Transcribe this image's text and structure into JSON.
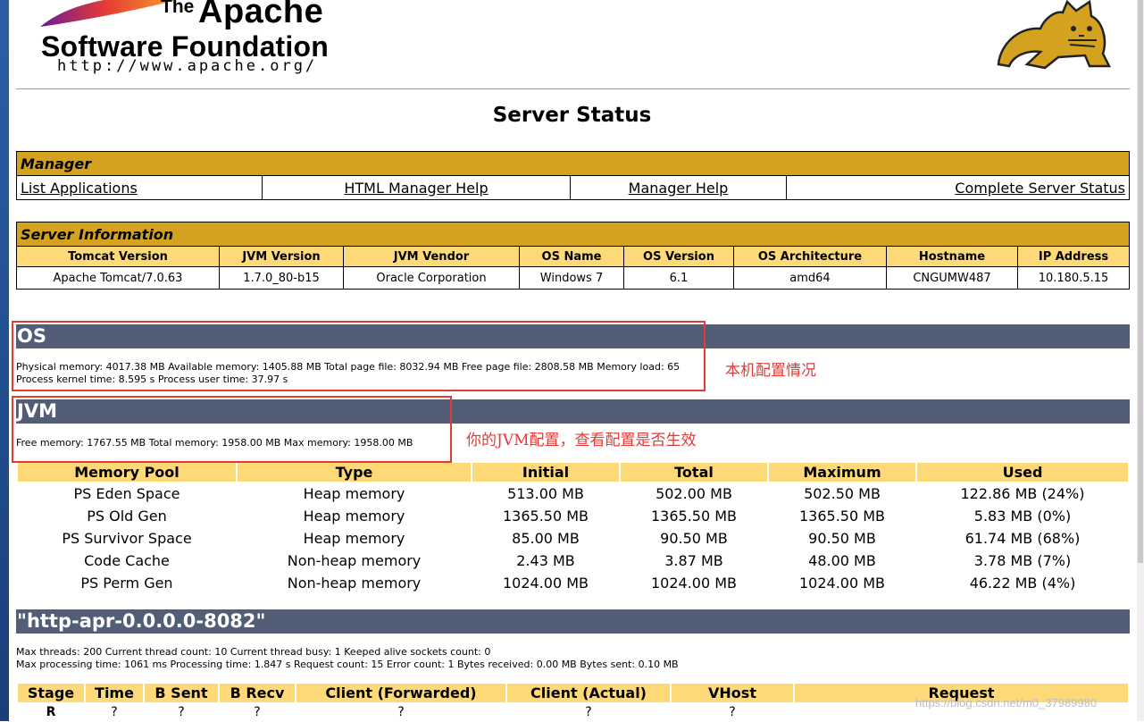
{
  "logo": {
    "the": "The",
    "apache": "Apache",
    "sf": "Software Foundation",
    "url": "http://www.apache.org/"
  },
  "page_title": "Server Status",
  "manager": {
    "header": "Manager",
    "links": [
      "List Applications",
      "HTML Manager Help",
      "Manager Help",
      "Complete Server Status"
    ]
  },
  "server_info": {
    "header": "Server Information",
    "columns": [
      "Tomcat Version",
      "JVM Version",
      "JVM Vendor",
      "OS Name",
      "OS Version",
      "OS Architecture",
      "Hostname",
      "IP Address"
    ],
    "values": [
      "Apache Tomcat/7.0.63",
      "1.7.0_80-b15",
      "Oracle Corporation",
      "Windows 7",
      "6.1",
      "amd64",
      "CNGUMW487",
      "10.180.5.15"
    ]
  },
  "os": {
    "title": "OS",
    "line1": "Physical memory: 4017.38 MB Available memory: 1405.88 MB Total page file: 8032.94 MB Free page file: 2808.58 MB Memory load: 65",
    "line2": "Process kernel time: 8.595 s Process user time: 37.97 s",
    "annotation": "本机配置情况"
  },
  "jvm": {
    "title": "JVM",
    "line1": "Free memory: 1767.55 MB Total memory: 1958.00 MB Max memory: 1958.00 MB",
    "annotation": "你的JVM配置，查看配置是否生效"
  },
  "memory_pool": {
    "columns": [
      "Memory Pool",
      "Type",
      "Initial",
      "Total",
      "Maximum",
      "Used"
    ],
    "rows": [
      [
        "PS Eden Space",
        "Heap memory",
        "513.00 MB",
        "502.00 MB",
        "502.50 MB",
        "122.86 MB (24%)"
      ],
      [
        "PS Old Gen",
        "Heap memory",
        "1365.50 MB",
        "1365.50 MB",
        "1365.50 MB",
        "5.83 MB (0%)"
      ],
      [
        "PS Survivor Space",
        "Heap memory",
        "85.00 MB",
        "90.50 MB",
        "90.50 MB",
        "61.74 MB (68%)"
      ],
      [
        "Code Cache",
        "Non-heap memory",
        "2.43 MB",
        "3.87 MB",
        "48.00 MB",
        "3.78 MB (7%)"
      ],
      [
        "PS Perm Gen",
        "Non-heap memory",
        "1024.00 MB",
        "1024.00 MB",
        "1024.00 MB",
        "46.22 MB (4%)"
      ]
    ]
  },
  "connector": {
    "title": "\"http-apr-0.0.0.0-8082\"",
    "line1": "Max threads: 200 Current thread count: 10 Current thread busy: 1 Keeped alive sockets count: 0",
    "line2": "Max processing time: 1061 ms Processing time: 1.847 s Request count: 15 Error count: 1 Bytes received: 0.00 MB Bytes sent: 0.10 MB"
  },
  "requests": {
    "columns": [
      "Stage",
      "Time",
      "B Sent",
      "B Recv",
      "Client (Forwarded)",
      "Client (Actual)",
      "VHost",
      "Request"
    ],
    "rows": [
      [
        "R",
        "?",
        "?",
        "?",
        "?",
        "?",
        "?",
        ""
      ]
    ]
  },
  "watermark": "https://blog.csdn.net/m0_37989980",
  "colors": {
    "bar_gold": "#d4a21e",
    "header_yellow": "#fdd978",
    "section_slate": "#525d76",
    "annotation_red": "#e53935"
  }
}
